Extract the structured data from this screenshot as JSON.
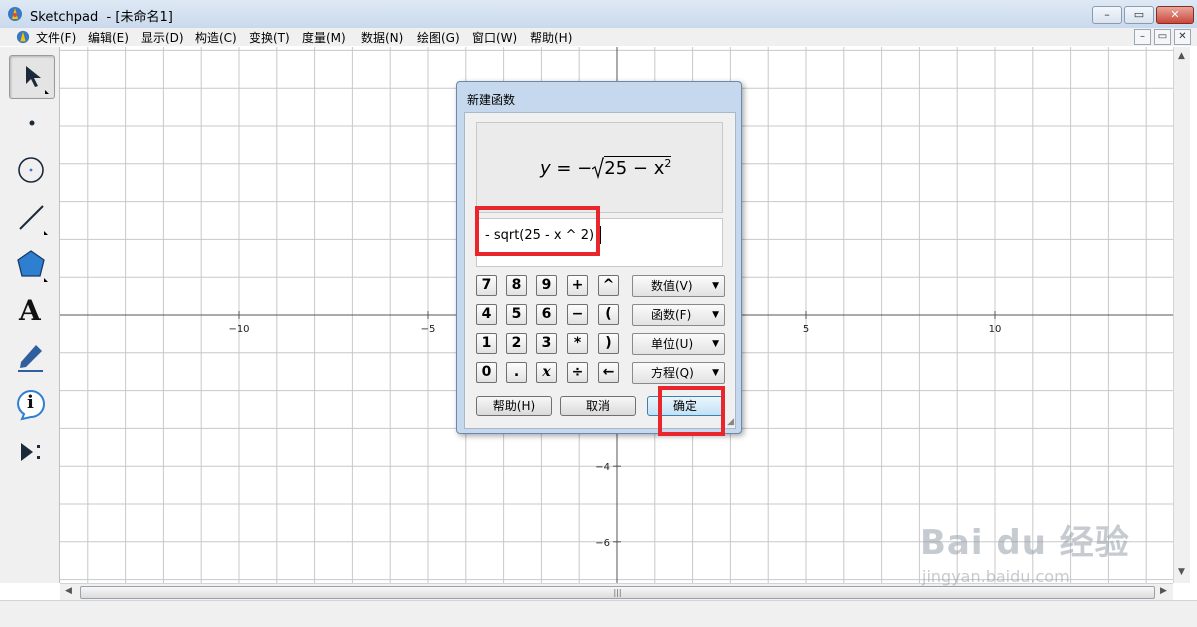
{
  "window": {
    "app_name": "Sketchpad",
    "doc_title": "- [未命名1]"
  },
  "window_controls": {
    "minimize": "–",
    "restore": "▭",
    "close": "✕"
  },
  "menu": [
    "文件(F)",
    "编辑(E)",
    "显示(D)",
    "构造(C)",
    "变换(T)",
    "度量(M)",
    "数据(N)",
    "绘图(G)",
    "窗口(W)",
    "帮助(H)"
  ],
  "mdi_controls": [
    "–",
    "▭",
    "✕"
  ],
  "toolbar": {
    "tools": [
      "arrow-select-tool",
      "point-tool",
      "compass-tool",
      "straightedge-tool",
      "polygon-tool",
      "text-tool",
      "marker-tool",
      "information-tool",
      "custom-tool"
    ],
    "selected": "arrow-select-tool",
    "text_tool_glyph": "A",
    "info_tool_glyph": "i"
  },
  "axes": {
    "x_labels": [
      "−10",
      "−5",
      "5",
      "10"
    ],
    "x_values": [
      -10,
      -5,
      5,
      10
    ],
    "y_labels": [
      "−4",
      "−6"
    ],
    "y_values": [
      -4,
      -6
    ]
  },
  "scrollbar": {
    "thumb_grip": "|||",
    "left_arrow": "◀",
    "right_arrow": "▶",
    "up_arrow": "▲",
    "down_arrow": "▼"
  },
  "dialog": {
    "title": "新建函数",
    "formula_preview": {
      "y": "y",
      "equals": " = −",
      "radicand": "25 − x",
      "exponent": "2"
    },
    "expression": "- sqrt(25 - x ^ 2)",
    "keypad": [
      [
        "7",
        "8",
        "9",
        "+",
        "^"
      ],
      [
        "4",
        "5",
        "6",
        "−",
        "("
      ],
      [
        "1",
        "2",
        "3",
        "*",
        ")"
      ],
      [
        "0",
        ".",
        "x",
        "÷",
        "←"
      ]
    ],
    "dropdowns": [
      "数值(V)",
      "函数(F)",
      "单位(U)",
      "方程(Q)"
    ],
    "dropdown_arrow": "▼",
    "buttons": {
      "help": "帮助(H)",
      "cancel": "取消",
      "ok": "确定"
    },
    "resize_grip": "◢"
  },
  "highlight_color": "#e8262c",
  "watermark": {
    "logo": "Bai du 经验",
    "url": "jingyan.baidu.com"
  }
}
